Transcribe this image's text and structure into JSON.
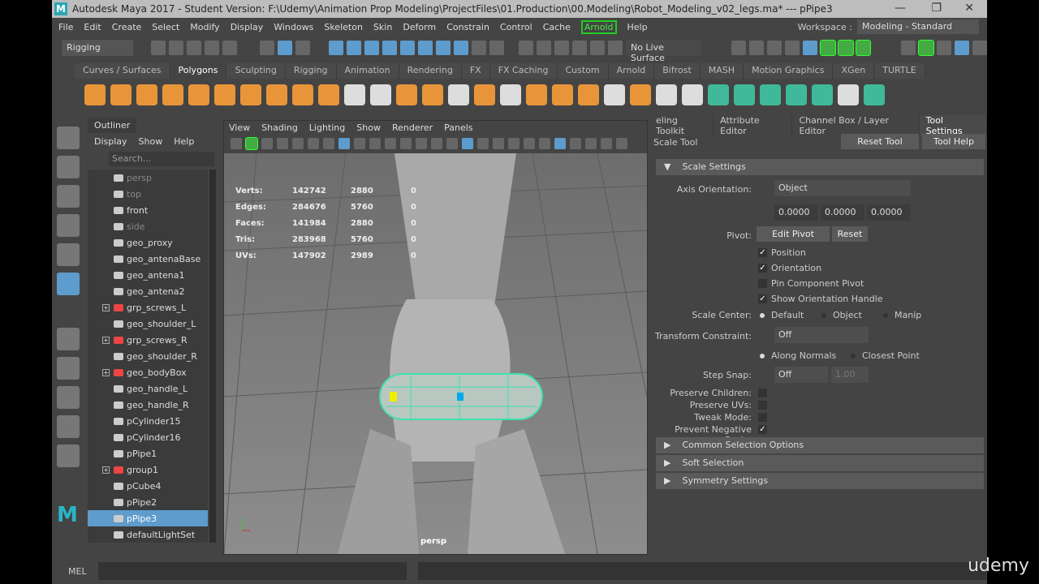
{
  "title": "Autodesk Maya 2017 - Student Version: F:\\Udemy\\Animation Prop Modeling\\ProjectFiles\\01.Production\\00.Modeling\\Robot_Modeling_v02_legs.ma*  ---  pPipe3",
  "menus": [
    "File",
    "Edit",
    "Create",
    "Select",
    "Modify",
    "Display",
    "Windows",
    "Skeleton",
    "Skin",
    "Deform",
    "Constrain",
    "Control",
    "Cache",
    "Arnold",
    "Help"
  ],
  "workspace": {
    "label": "Workspace :",
    "value": "Modeling - Standard"
  },
  "status": {
    "menu_set": "Rigging",
    "live_surface": "No Live Surface"
  },
  "shelf_tabs": [
    "Curves / Surfaces",
    "Polygons",
    "Sculpting",
    "Rigging",
    "Animation",
    "Rendering",
    "FX",
    "FX Caching",
    "Custom",
    "Arnold",
    "Bifrost",
    "MASH",
    "Motion Graphics",
    "XGen",
    "TURTLE"
  ],
  "outliner": {
    "tab": "Outliner",
    "menus": [
      "Display",
      "Show",
      "Help"
    ],
    "search_placeholder": "Search...",
    "items": [
      {
        "name": "persp",
        "dim": true
      },
      {
        "name": "top",
        "dim": true
      },
      {
        "name": "front"
      },
      {
        "name": "side",
        "dim": true
      },
      {
        "name": "geo_proxy"
      },
      {
        "name": "geo_antenaBase"
      },
      {
        "name": "geo_antena1"
      },
      {
        "name": "geo_antena2"
      },
      {
        "name": "grp_screws_L",
        "group": true
      },
      {
        "name": "geo_shoulder_L"
      },
      {
        "name": "grp_screws_R",
        "group": true
      },
      {
        "name": "geo_shoulder_R"
      },
      {
        "name": "geo_bodyBox",
        "group": true
      },
      {
        "name": "geo_handle_L"
      },
      {
        "name": "geo_handle_R"
      },
      {
        "name": "pCylinder15"
      },
      {
        "name": "pCylinder16"
      },
      {
        "name": "pPipe1"
      },
      {
        "name": "group1",
        "group": true
      },
      {
        "name": "pCube4"
      },
      {
        "name": "pPipe2"
      },
      {
        "name": "pPipe3",
        "selected": true
      },
      {
        "name": "defaultLightSet"
      }
    ]
  },
  "viewport": {
    "menus": [
      "View",
      "Shading",
      "Lighting",
      "Show",
      "Renderer",
      "Panels"
    ],
    "camera": "persp",
    "stats": [
      [
        "Verts:",
        "142742",
        "2880",
        "0"
      ],
      [
        "Edges:",
        "284676",
        "5760",
        "0"
      ],
      [
        "Faces:",
        "141984",
        "2880",
        "0"
      ],
      [
        "Tris:",
        "283968",
        "5760",
        "0"
      ],
      [
        "UVs:",
        "147902",
        "2989",
        "0"
      ]
    ]
  },
  "right_panel": {
    "tabs": [
      "eling Toolkit",
      "Attribute Editor",
      "Channel Box / Layer Editor",
      "Tool Settings"
    ],
    "tool": "Scale Tool",
    "reset_tool": "Reset Tool",
    "tool_help": "Tool Help",
    "scale_settings": "Scale Settings",
    "axis_orientation_label": "Axis Orientation:",
    "axis_orientation": "Object",
    "xyz": [
      "0.0000",
      "0.0000",
      "0.0000"
    ],
    "pivot_label": "Pivot:",
    "edit_pivot": "Edit Pivot",
    "reset": "Reset",
    "position": "Position",
    "orientation": "Orientation",
    "pin_component_pivot": "Pin Component Pivot",
    "show_orientation_handle": "Show Orientation Handle",
    "scale_center_label": "Scale Center:",
    "scale_center": [
      "Default",
      "Object",
      "Manip"
    ],
    "transform_constraint_label": "Transform Constraint:",
    "transform_constraint": "Off",
    "constraint_modes": [
      "Along Normals",
      "Closest Point"
    ],
    "step_snap_label": "Step Snap:",
    "step_snap": "Off",
    "step_value": "1.00",
    "preserve_children": "Preserve Children:",
    "preserve_uvs": "Preserve UVs:",
    "tweak_mode": "Tweak Mode:",
    "prevent_negative_scale": "Prevent Negative Scale:",
    "sections": [
      "Common Selection Options",
      "Soft Selection",
      "Symmetry Settings"
    ]
  },
  "command_line": {
    "label": "MEL"
  },
  "watermark": "udemy"
}
